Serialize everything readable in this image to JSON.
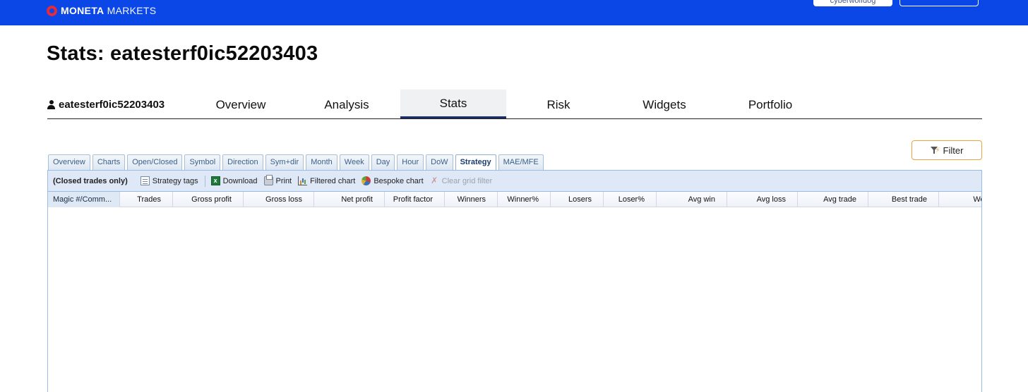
{
  "header": {
    "brand_bold": "MONETA",
    "brand_thin": " MARKETS",
    "user_pill": "cyberwolfdog"
  },
  "page": {
    "title": "Stats: eatesterf0ic52203403"
  },
  "nav": {
    "username": "eatesterf0ic52203403",
    "tabs": [
      "Overview",
      "Analysis",
      "Stats",
      "Risk",
      "Widgets",
      "Portfolio"
    ],
    "active_tab": "Stats"
  },
  "filter": {
    "label": "Filter"
  },
  "subtabs": {
    "items": [
      "Overview",
      "Charts",
      "Open/Closed",
      "Symbol",
      "Direction",
      "Sym+dir",
      "Month",
      "Week",
      "Day",
      "Hour",
      "DoW",
      "Strategy",
      "MAE/MFE"
    ],
    "active": "Strategy"
  },
  "toolbar": {
    "closed_only": "(Closed trades only)",
    "strategy_tags": "Strategy tags",
    "download": "Download",
    "print": "Print",
    "filtered_chart": "Filtered chart",
    "bespoke_chart": "Bespoke chart",
    "clear_grid_filter": "Clear grid filter"
  },
  "grid": {
    "columns": [
      "Magic #/Comm...",
      "Trades",
      "Gross profit",
      "Gross loss",
      "Net profit",
      "Profit factor",
      "Winners",
      "Winner%",
      "Losers",
      "Loser%",
      "Avg win",
      "Avg loss",
      "Avg trade",
      "Best trade",
      "Worst t"
    ],
    "rows": []
  },
  "colors": {
    "header_bg": "#0a47e6",
    "brand_accent": "#e52a3a",
    "active_tab_underline": "#1c2d6b",
    "filter_border": "#e8a53a",
    "grid_border": "#99bbe8",
    "toolbar_bg": "#dfe8f6"
  }
}
